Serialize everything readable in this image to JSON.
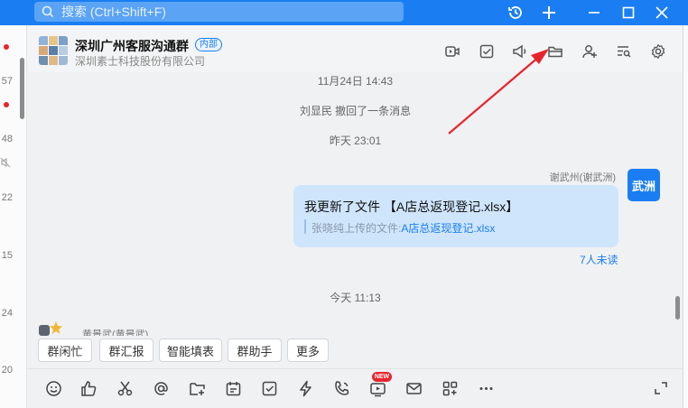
{
  "search": {
    "placeholder": "搜索 (Ctrl+Shift+F)"
  },
  "window_controls": [
    "history-icon",
    "add-icon",
    "minimize-icon",
    "maximize-icon",
    "close-icon"
  ],
  "left_strip": {
    "items": [
      "57",
      "48",
      "22",
      "15",
      "24",
      "20"
    ]
  },
  "header": {
    "group_name": "深圳广州客服沟通群",
    "badge": "内部",
    "company": "深圳素士科技股份有限公司",
    "icons": [
      "video-icon",
      "task-icon",
      "announcement-icon",
      "folder-icon",
      "add-member-icon",
      "search-history-icon",
      "settings-icon"
    ]
  },
  "chat": {
    "messages": [
      {
        "type": "system",
        "text": "11月24日 14:43"
      },
      {
        "type": "system",
        "text": "刘显民 撤回了一条消息"
      },
      {
        "type": "system",
        "text": "昨天 23:01"
      },
      {
        "type": "outgoing",
        "sender": "谢武州(谢武洲)",
        "avatar_text": "武洲",
        "text": "我更新了文件 【A店总返现登记.xlsx】",
        "file_prefix": "张晓纯上传的文件:",
        "file_link": "A店总返现登记.xlsx",
        "status": "7人未读"
      },
      {
        "type": "system",
        "text": "今天 11:13"
      }
    ],
    "next_sender_partial": "黄景武(黄景武)"
  },
  "quick_buttons": [
    "群闲忙",
    "群汇报",
    "智能填表",
    "群助手",
    "更多"
  ],
  "toolbar": {
    "icons": [
      "emoji-icon",
      "like-icon",
      "scissors-icon",
      "mention-icon",
      "folder-add-icon",
      "calendar-icon",
      "todo-icon",
      "ding-icon",
      "phone-icon",
      "live-icon",
      "mail-icon",
      "apps-icon",
      "more-icon"
    ],
    "new_badge": "NEW",
    "expand_icon": "expand-icon"
  },
  "colors": {
    "brand_blue": "#1a7ef2",
    "bubble": "#cfe5fc",
    "red_arrow": "#e8232c"
  }
}
